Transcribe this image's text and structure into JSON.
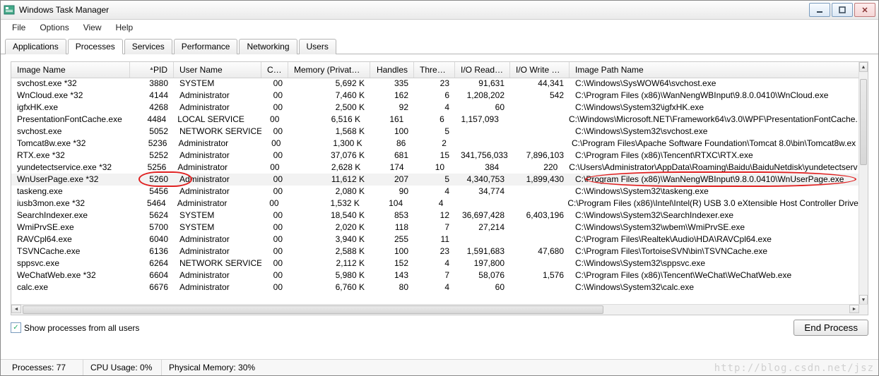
{
  "window": {
    "title": "Windows Task Manager"
  },
  "window_buttons": {
    "min": "minimize-icon",
    "max": "maximize-icon",
    "close": "close-icon"
  },
  "menu": [
    "File",
    "Options",
    "View",
    "Help"
  ],
  "tabs": [
    "Applications",
    "Processes",
    "Services",
    "Performance",
    "Networking",
    "Users"
  ],
  "active_tab_index": 1,
  "columns": [
    "Image Name",
    "PID",
    "User Name",
    "CPU",
    "Memory (Private ...",
    "Handles",
    "Threads",
    "I/O Read B...",
    "I/O Write Bytes",
    "Image Path Name"
  ],
  "sort_column_index": 1,
  "highlight_row_index": 8,
  "rows": [
    {
      "img": "svchost.exe *32",
      "pid": "3880",
      "user": "SYSTEM",
      "cpu": "00",
      "mem": "5,692 K",
      "hnd": "335",
      "thr": "23",
      "ior": "91,631",
      "iow": "44,341",
      "path": "C:\\Windows\\SysWOW64\\svchost.exe"
    },
    {
      "img": "WnCloud.exe *32",
      "pid": "4144",
      "user": "Administrator",
      "cpu": "00",
      "mem": "7,460 K",
      "hnd": "162",
      "thr": "6",
      "ior": "1,208,202",
      "iow": "542",
      "path": "C:\\Program Files (x86)\\WanNengWBInput\\9.8.0.0410\\WnCloud.exe"
    },
    {
      "img": "igfxHK.exe",
      "pid": "4268",
      "user": "Administrator",
      "cpu": "00",
      "mem": "2,500 K",
      "hnd": "92",
      "thr": "4",
      "ior": "60",
      "iow": "",
      "path": "C:\\Windows\\System32\\igfxHK.exe"
    },
    {
      "img": "PresentationFontCache.exe",
      "pid": "4484",
      "user": "LOCAL SERVICE",
      "cpu": "00",
      "mem": "6,516 K",
      "hnd": "161",
      "thr": "6",
      "ior": "1,157,093",
      "iow": "",
      "path": "C:\\Windows\\Microsoft.NET\\Framework64\\v3.0\\WPF\\PresentationFontCache."
    },
    {
      "img": "svchost.exe",
      "pid": "5052",
      "user": "NETWORK SERVICE",
      "cpu": "00",
      "mem": "1,568 K",
      "hnd": "100",
      "thr": "5",
      "ior": "",
      "iow": "",
      "path": "C:\\Windows\\System32\\svchost.exe"
    },
    {
      "img": "Tomcat8w.exe *32",
      "pid": "5236",
      "user": "Administrator",
      "cpu": "00",
      "mem": "1,300 K",
      "hnd": "86",
      "thr": "2",
      "ior": "",
      "iow": "",
      "path": "C:\\Program Files\\Apache Software Foundation\\Tomcat 8.0\\bin\\Tomcat8w.ex"
    },
    {
      "img": "RTX.exe *32",
      "pid": "5252",
      "user": "Administrator",
      "cpu": "00",
      "mem": "37,076 K",
      "hnd": "681",
      "thr": "15",
      "ior": "341,756,033",
      "iow": "7,896,103",
      "path": "C:\\Program Files (x86)\\Tencent\\RTXC\\RTX.exe"
    },
    {
      "img": "yundetectservice.exe *32",
      "pid": "5256",
      "user": "Administrator",
      "cpu": "00",
      "mem": "2,628 K",
      "hnd": "174",
      "thr": "10",
      "ior": "384",
      "iow": "220",
      "path": "C:\\Users\\Administrator\\AppData\\Roaming\\Baidu\\BaiduNetdisk\\yundetectserv"
    },
    {
      "img": "WnUserPage.exe *32",
      "pid": "5260",
      "user": "Administrator",
      "cpu": "00",
      "mem": "11,612 K",
      "hnd": "207",
      "thr": "5",
      "ior": "4,340,753",
      "iow": "1,899,430",
      "path": "C:\\Program Files (x86)\\WanNengWBInput\\9.8.0.0410\\WnUserPage.exe"
    },
    {
      "img": "taskeng.exe",
      "pid": "5456",
      "user": "Administrator",
      "cpu": "00",
      "mem": "2,080 K",
      "hnd": "90",
      "thr": "4",
      "ior": "34,774",
      "iow": "",
      "path": "C:\\Windows\\System32\\taskeng.exe"
    },
    {
      "img": "iusb3mon.exe *32",
      "pid": "5464",
      "user": "Administrator",
      "cpu": "00",
      "mem": "1,532 K",
      "hnd": "104",
      "thr": "4",
      "ior": "",
      "iow": "",
      "path": "C:\\Program Files (x86)\\Intel\\Intel(R) USB 3.0 eXtensible Host Controller Drive"
    },
    {
      "img": "SearchIndexer.exe",
      "pid": "5624",
      "user": "SYSTEM",
      "cpu": "00",
      "mem": "18,540 K",
      "hnd": "853",
      "thr": "12",
      "ior": "36,697,428",
      "iow": "6,403,196",
      "path": "C:\\Windows\\System32\\SearchIndexer.exe"
    },
    {
      "img": "WmiPrvSE.exe",
      "pid": "5700",
      "user": "SYSTEM",
      "cpu": "00",
      "mem": "2,020 K",
      "hnd": "118",
      "thr": "7",
      "ior": "27,214",
      "iow": "",
      "path": "C:\\Windows\\System32\\wbem\\WmiPrvSE.exe"
    },
    {
      "img": "RAVCpl64.exe",
      "pid": "6040",
      "user": "Administrator",
      "cpu": "00",
      "mem": "3,940 K",
      "hnd": "255",
      "thr": "11",
      "ior": "",
      "iow": "",
      "path": "C:\\Program Files\\Realtek\\Audio\\HDA\\RAVCpl64.exe"
    },
    {
      "img": "TSVNCache.exe",
      "pid": "6136",
      "user": "Administrator",
      "cpu": "00",
      "mem": "2,588 K",
      "hnd": "100",
      "thr": "23",
      "ior": "1,591,683",
      "iow": "47,680",
      "path": "C:\\Program Files\\TortoiseSVN\\bin\\TSVNCache.exe"
    },
    {
      "img": "sppsvc.exe",
      "pid": "6264",
      "user": "NETWORK SERVICE",
      "cpu": "00",
      "mem": "2,112 K",
      "hnd": "152",
      "thr": "4",
      "ior": "197,800",
      "iow": "",
      "path": "C:\\Windows\\System32\\sppsvc.exe"
    },
    {
      "img": "WeChatWeb.exe *32",
      "pid": "6604",
      "user": "Administrator",
      "cpu": "00",
      "mem": "5,980 K",
      "hnd": "143",
      "thr": "7",
      "ior": "58,076",
      "iow": "1,576",
      "path": "C:\\Program Files (x86)\\Tencent\\WeChat\\WeChatWeb.exe"
    },
    {
      "img": "calc.exe",
      "pid": "6676",
      "user": "Administrator",
      "cpu": "00",
      "mem": "6,760 K",
      "hnd": "80",
      "thr": "4",
      "ior": "60",
      "iow": "",
      "path": "C:\\Windows\\System32\\calc.exe"
    }
  ],
  "show_all_label": "Show processes from all users",
  "show_all_checked": true,
  "end_process_label": "End Process",
  "status": {
    "processes_label": "Processes: 77",
    "cpu_label": "CPU Usage: 0%",
    "mem_label": "Physical Memory: 30%"
  },
  "watermark": "http://blog.csdn.net/jsz"
}
